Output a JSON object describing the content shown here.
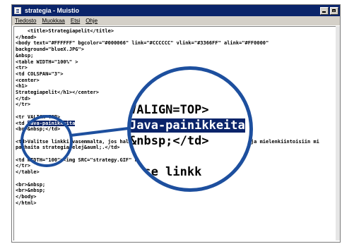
{
  "window": {
    "title": "strategia - Muistio",
    "menu": [
      "Tiedosto",
      "Muokkaa",
      "Etsi",
      "Ohje"
    ]
  },
  "code_lines": [
    "    <title>Strategiapelit</title>",
    "</head>",
    "<body text=\"#FFFFFF\" bgcolor=\"#000066\" link=\"#CCCCCC\" vlink=\"#3366FF\" alink=\"#FF0000\"",
    "background=\"blueX.JPG\">",
    "&nbsp;",
    "<table WIDTH=\"100%\" >",
    "<tr>",
    "<td COLSPAN=\"3\">",
    "<center>",
    "<h1>",
    "Strategiapelit</h1></center>",
    "</td>",
    "</tr>",
    "",
    "<tr VALIGN=TOP>",
    "<td ",
    "<br>&nbsp;</td>",
    "",
    "<td>Valitse linkki vasemmalta, jos haluat tutustua joihinkin mielenkiintoisiin ja mielenkiintoisiin mi",
    "parhaita strategiapelej&auml;.</td>",
    "",
    "<td WIDTH=\"100\"><img SRC=\"strategy.GIF\" height=\"100\" width=\"100\"></td>",
    "</tr>",
    "</table>",
    "",
    "<br>&nbsp;",
    "<br>&nbsp;",
    "</body>",
    "</html>"
  ],
  "highlight": "Java-painikkeita",
  "zoom": {
    "line1": "VALIGN=TOP>",
    "line2": "Java-painikkeita",
    "line3": "&nbsp;</td>",
    "line4": "",
    "line5": "itse linkk"
  }
}
